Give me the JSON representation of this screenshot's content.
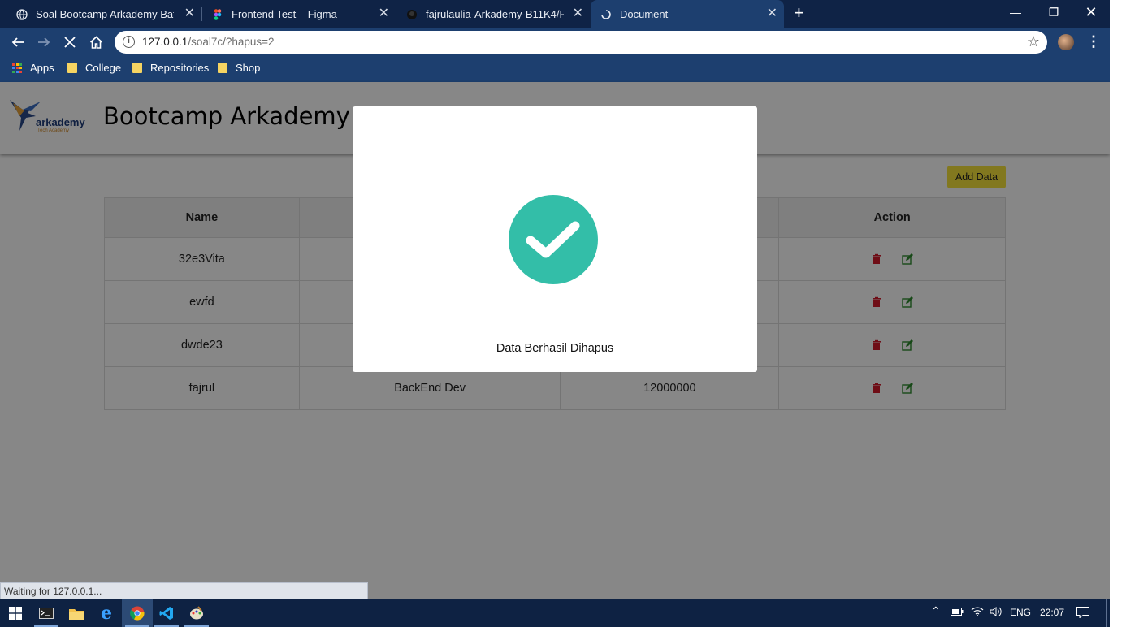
{
  "browser": {
    "tabs": [
      {
        "title": "Soal Bootcamp Arkademy Batch",
        "active": false
      },
      {
        "title": "Frontend Test – Figma",
        "active": false
      },
      {
        "title": "fajrulaulia-Arkademy-B11K4/REA",
        "active": false
      },
      {
        "title": "Document",
        "active": true
      }
    ],
    "new_tab_label": "+",
    "url_host": "127.0.0.1",
    "url_path": "/soal7c/?hapus=2",
    "bookmarks": [
      "Apps",
      "College",
      "Repositories",
      "Shop"
    ],
    "status_text": "Waiting for 127.0.0.1..."
  },
  "site": {
    "title": "Bootcamp Arkademy",
    "logo_text": "arkademy",
    "logo_subtext": "Tech Academy",
    "add_button": "Add Data"
  },
  "table": {
    "headers": [
      "Name",
      "",
      "",
      "Action"
    ],
    "rows": [
      {
        "name": "32e3Vita",
        "job": "",
        "salary": ""
      },
      {
        "name": "ewfd",
        "job": "",
        "salary": ""
      },
      {
        "name": "dwde23",
        "job": "",
        "salary": ""
      },
      {
        "name": "fajrul",
        "job": "BackEnd Dev",
        "salary": "12000000"
      }
    ]
  },
  "modal": {
    "icon": "check-icon",
    "message": "Data Berhasil Dihapus",
    "accent": "#33bea8"
  },
  "taskbar": {
    "language": "ENG",
    "time": "22:07"
  }
}
